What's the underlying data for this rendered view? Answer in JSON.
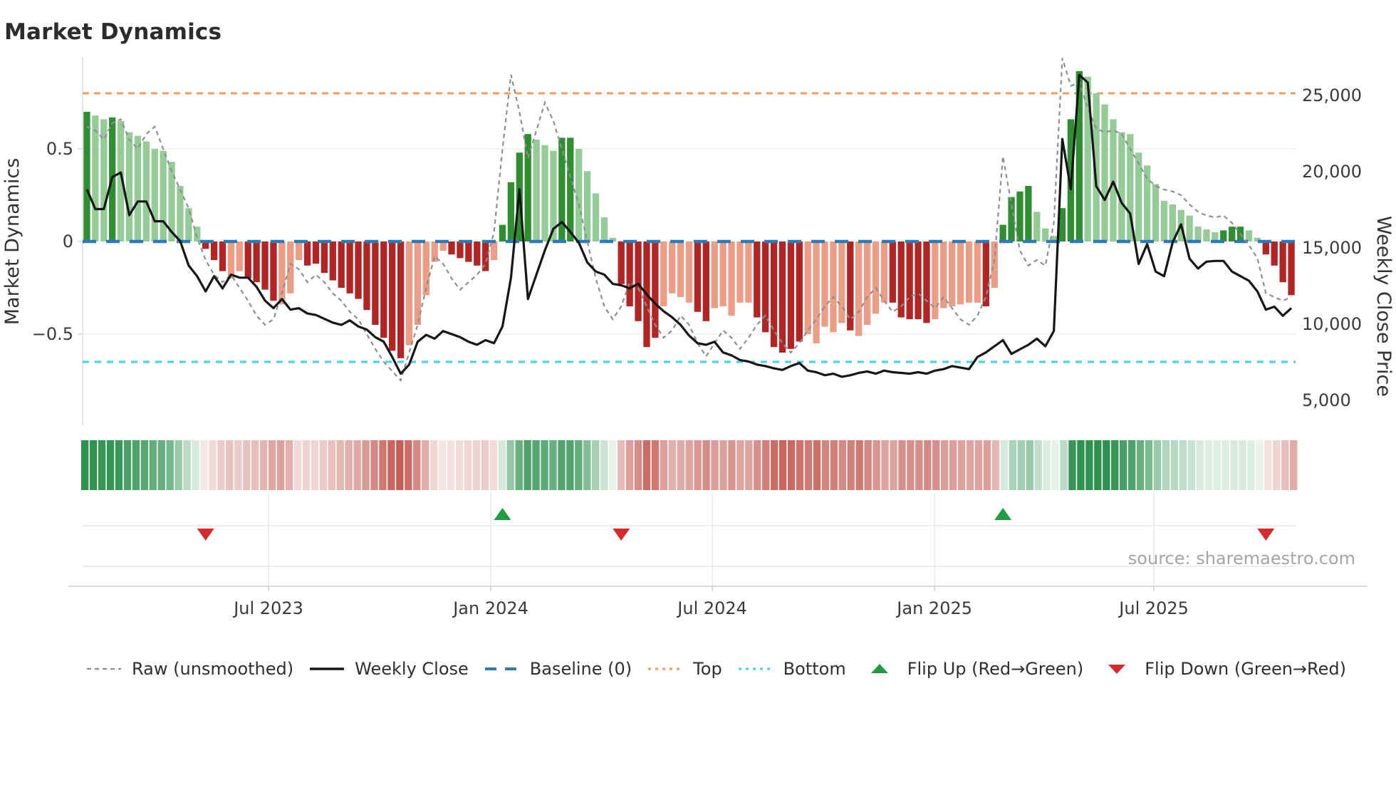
{
  "title": "Market Dynamics",
  "source": "source: sharemaestro.com",
  "axes": {
    "left_label": "Market Dynamics",
    "right_label": "Weekly Close Price",
    "left_ticks": [
      {
        "label": "0.5",
        "value": 0.5
      },
      {
        "label": "0",
        "value": 0
      },
      {
        "label": "−0.5",
        "value": -0.5
      }
    ],
    "right_ticks": [
      {
        "label": "25,000",
        "value": 25000
      },
      {
        "label": "20,000",
        "value": 20000
      },
      {
        "label": "15,000",
        "value": 15000
      },
      {
        "label": "10,000",
        "value": 10000
      },
      {
        "label": "5,000",
        "value": 5000
      }
    ],
    "x_ticks": [
      {
        "label": "Jul 2023",
        "wf": 21.92
      },
      {
        "label": "Jan 2024",
        "wf": 48.12
      },
      {
        "label": "Jul 2024",
        "wf": 74.24
      },
      {
        "label": "Jan 2025",
        "wf": 100.44
      },
      {
        "label": "Jul 2025",
        "wf": 126.3
      }
    ]
  },
  "legend": [
    {
      "id": "raw",
      "label": "Raw (unsmoothed)",
      "swatch": "dashed-line",
      "color": "#8f8f8f"
    },
    {
      "id": "close",
      "label": "Weekly Close",
      "swatch": "solid-line",
      "color": "#161616"
    },
    {
      "id": "baseline",
      "label": "Baseline (0)",
      "swatch": "long-dash",
      "color": "#2f7ab5"
    },
    {
      "id": "top",
      "label": "Top",
      "swatch": "dotted-line",
      "color": "#f0a05a"
    },
    {
      "id": "bottom",
      "label": "Bottom",
      "swatch": "dotted-line",
      "color": "#4fd2e2"
    },
    {
      "id": "flip-up",
      "label": "Flip Up (Red→Green)",
      "swatch": "triangle-up",
      "color": "#219a44"
    },
    {
      "id": "flip-down",
      "label": "Flip Down (Green→Red)",
      "swatch": "triangle-down",
      "color": "#d62b2b"
    }
  ],
  "colors": {
    "dark_green": "#2f8e32",
    "light_green": "#94cb96",
    "dark_red": "#b22525",
    "salmon": "#eb9d85",
    "baseline_blue": "#2f7ab5",
    "top_orange": "#f0a05a",
    "bottom_cyan": "#4fd2e2",
    "raw_gray": "#8f8f8f",
    "close_black": "#161616",
    "flip_up_green": "#219a44",
    "flip_down_red": "#d62b2b",
    "heat_green": "#2e9150",
    "heat_red": "#bf5048",
    "grid": "#edeef3",
    "spine": "#d8dbe2",
    "panel_grid": "#e8e8ea",
    "panel_axis": "#cfcfd4",
    "tick_text": "#3a3a3a",
    "title_text": "#2c2c2c",
    "source_text": "#a5a5a5"
  },
  "chart_data": {
    "type": "bar",
    "title": "Market Dynamics",
    "ylabel_left": "Market Dynamics",
    "ylabel_right": "Weekly Close Price",
    "ylim_left": [
      -1.0,
      1.0
    ],
    "ylim_right": [
      3300,
      27500
    ],
    "baseline": 0,
    "top_threshold": 0.8,
    "bottom_threshold": -0.65,
    "weeks": 143,
    "bar_values": [
      0.7,
      0.68,
      0.66,
      0.67,
      0.65,
      0.59,
      0.57,
      0.54,
      0.5,
      0.49,
      0.43,
      0.3,
      0.18,
      0.08,
      -0.04,
      -0.1,
      -0.16,
      -0.2,
      -0.16,
      -0.2,
      -0.22,
      -0.26,
      -0.32,
      -0.34,
      -0.28,
      -0.1,
      -0.13,
      -0.12,
      -0.17,
      -0.21,
      -0.25,
      -0.28,
      -0.31,
      -0.37,
      -0.45,
      -0.52,
      -0.59,
      -0.63,
      -0.56,
      -0.45,
      -0.29,
      -0.11,
      -0.05,
      -0.07,
      -0.09,
      -0.11,
      -0.13,
      -0.16,
      -0.1,
      0.09,
      0.32,
      0.48,
      0.58,
      0.55,
      0.52,
      0.49,
      0.56,
      0.56,
      0.5,
      0.38,
      0.26,
      0.13,
      0.02,
      -0.23,
      -0.35,
      -0.43,
      -0.57,
      -0.52,
      -0.35,
      -0.28,
      -0.3,
      -0.33,
      -0.38,
      -0.43,
      -0.36,
      -0.35,
      -0.4,
      -0.33,
      -0.33,
      -0.41,
      -0.49,
      -0.57,
      -0.6,
      -0.58,
      -0.54,
      -0.5,
      -0.55,
      -0.46,
      -0.49,
      -0.44,
      -0.48,
      -0.51,
      -0.45,
      -0.39,
      -0.33,
      -0.33,
      -0.41,
      -0.42,
      -0.42,
      -0.44,
      -0.42,
      -0.36,
      -0.35,
      -0.34,
      -0.33,
      -0.33,
      -0.35,
      -0.25,
      0.09,
      0.24,
      0.27,
      0.3,
      0.16,
      0.07,
      0.03,
      0.18,
      0.66,
      0.92,
      0.89,
      0.8,
      0.74,
      0.66,
      0.59,
      0.58,
      0.48,
      0.41,
      0.31,
      0.22,
      0.2,
      0.17,
      0.14,
      0.08,
      0.065,
      0.05,
      0.06,
      0.08,
      0.08,
      0.06,
      0.02,
      -0.07,
      -0.13,
      -0.22,
      -0.29
    ],
    "bar_shades": "GggGggggggggggRRRrrRRRRrrrRRRRRRRRRRRRrrrrrRRRRRrGGGGgggGGgggggRRRRRrrrrRRrrrrrRRRRRRrrrrrRrrrrRRRRRrrrrrrRrGGGGgggGGGggggggggggggggggGGGggRRRR",
    "weekly_close": [
      18800,
      17500,
      17500,
      19600,
      19900,
      17100,
      18000,
      18000,
      16700,
      16700,
      16000,
      15400,
      13800,
      13100,
      12100,
      13100,
      12300,
      13200,
      13000,
      13000,
      12400,
      11500,
      11000,
      11600,
      10900,
      11000,
      10650,
      10550,
      10300,
      10050,
      9900,
      10200,
      9800,
      9600,
      9100,
      8800,
      7800,
      6700,
      7300,
      8800,
      9250,
      9000,
      9500,
      9300,
      9100,
      8800,
      8600,
      8900,
      8700,
      9800,
      13000,
      18800,
      11600,
      13200,
      14800,
      16200,
      16650,
      16000,
      15300,
      14000,
      13400,
      13200,
      12600,
      12500,
      12300,
      12600,
      11900,
      11300,
      10800,
      10400,
      9900,
      9200,
      8700,
      8600,
      8800,
      8100,
      7900,
      7600,
      7500,
      7300,
      7200,
      7050,
      6950,
      7200,
      7400,
      6900,
      6800,
      6600,
      6700,
      6500,
      6600,
      6750,
      6850,
      6700,
      6900,
      6800,
      6750,
      6700,
      6800,
      6700,
      6900,
      7000,
      7200,
      7100,
      7000,
      7800,
      8100,
      8500,
      8900,
      8000,
      8300,
      8600,
      9000,
      8500,
      9500,
      22100,
      18800,
      26300,
      25800,
      19000,
      18100,
      19300,
      17900,
      17200,
      13900,
      15200,
      13400,
      13100,
      15300,
      16500,
      14250,
      13600,
      14050,
      14100,
      14100,
      13400,
      13100,
      12800,
      12100,
      10900,
      11100,
      10500,
      11000
    ],
    "raw_unsmoothed": [
      0.62,
      0.6,
      0.55,
      0.64,
      0.66,
      0.55,
      0.5,
      0.58,
      0.62,
      0.5,
      0.38,
      0.28,
      0.18,
      0.02,
      -0.1,
      -0.18,
      -0.22,
      -0.18,
      -0.25,
      -0.32,
      -0.4,
      -0.45,
      -0.42,
      -0.28,
      -0.12,
      -0.15,
      -0.22,
      -0.18,
      -0.22,
      -0.28,
      -0.32,
      -0.38,
      -0.42,
      -0.5,
      -0.58,
      -0.65,
      -0.7,
      -0.75,
      -0.6,
      -0.45,
      -0.25,
      -0.08,
      -0.12,
      -0.2,
      -0.26,
      -0.22,
      -0.18,
      -0.12,
      0.05,
      0.5,
      0.9,
      0.7,
      0.45,
      0.6,
      0.75,
      0.65,
      0.5,
      0.35,
      0.2,
      0.0,
      -0.2,
      -0.35,
      -0.42,
      -0.35,
      -0.22,
      -0.25,
      -0.35,
      -0.45,
      -0.52,
      -0.48,
      -0.4,
      -0.45,
      -0.55,
      -0.62,
      -0.55,
      -0.48,
      -0.52,
      -0.58,
      -0.52,
      -0.45,
      -0.4,
      -0.48,
      -0.55,
      -0.6,
      -0.55,
      -0.48,
      -0.42,
      -0.35,
      -0.3,
      -0.35,
      -0.42,
      -0.38,
      -0.3,
      -0.25,
      -0.32,
      -0.38,
      -0.35,
      -0.3,
      -0.28,
      -0.32,
      -0.36,
      -0.3,
      -0.36,
      -0.42,
      -0.45,
      -0.4,
      -0.3,
      -0.1,
      0.46,
      0.2,
      -0.05,
      -0.13,
      -0.1,
      -0.13,
      0.1,
      0.99,
      0.84,
      0.86,
      0.72,
      0.61,
      0.59,
      0.6,
      0.58,
      0.5,
      0.42,
      0.34,
      0.3,
      0.28,
      0.27,
      0.25,
      0.2,
      0.16,
      0.14,
      0.13,
      0.14,
      0.1,
      0.04,
      -0.02,
      -0.09,
      -0.28,
      -0.3,
      -0.32,
      -0.3
    ],
    "flip_up_weeks": [
      49,
      108
    ],
    "flip_down_weeks": [
      14,
      63,
      139
    ],
    "grid": "horizontal at ±0.5",
    "legend_position": "bottom"
  }
}
